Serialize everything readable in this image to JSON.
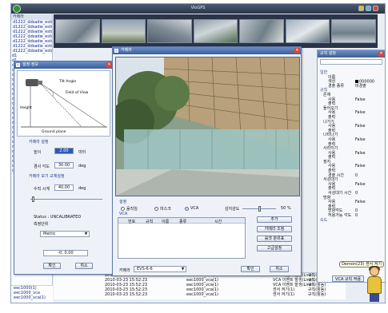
{
  "app": {
    "title": "VioGPS"
  },
  "tree": {
    "header": "카메라",
    "items": [
      "d1222_ddsadw_est(5)",
      "d1222_ddsadw_est(1)",
      "d1222_ddsadw_est(2)",
      "d1222_ddsadw_est(3)",
      "d1222_ddsadw_est(4)",
      "d1222_ddsadw_est(5)",
      "d1222_ddsadw_est(6)"
    ],
    "short_items": [
      "d1",
      "d1",
      "d1",
      "d1",
      "d1",
      "d1",
      "d1",
      "d1",
      "d1",
      "d1",
      "d1",
      "d1",
      "d1",
      "d1",
      "d1",
      "d1",
      "d1",
      "d1",
      "d1",
      "d1",
      "d1",
      "d1",
      "d1",
      "d1",
      "d1"
    ],
    "bottom_items": [
      "eec1000(1)",
      "eec1000_vca",
      "eec1000_vca(1)"
    ]
  },
  "camera_dialog": {
    "title": "설정 정보",
    "diagram_labels": {
      "tilt_angle": "Tilt Angle",
      "field_of_view": "Field of View",
      "height": "Height",
      "ground_plane": "Ground plane"
    },
    "section_camera": "카메라 설정",
    "height_label": "높이",
    "height_value": "2.00",
    "height_unit": "미터",
    "tilt_label": "경사 각도",
    "tilt_value": "30.00",
    "tilt_unit": "deg",
    "section_camera2": "카메라 보기 교체설정",
    "fov_label": "수직 시계",
    "fov_value": "40.00",
    "fov_unit": "deg",
    "status": "Status : UNCALIBRATED",
    "unit_label": "측정단위",
    "unit_value": "Metric",
    "coordinate_label": "-0, 0.00",
    "ok_button": "확인",
    "cancel_button": "취소"
  },
  "vca_dialog": {
    "title": "카메라",
    "group_label": "설정",
    "radio_motion": "움직임",
    "radio_mask": "마스크",
    "radio_vca": "VCA",
    "sensitivity_label": "감지감도",
    "sensitivity_value": "50 %",
    "vca_label": "VCA",
    "table_headers": [
      "번호",
      "규칙",
      "이름",
      "종류",
      "시간"
    ],
    "buttons": [
      "추가",
      "카메라 조정",
      "룰셋 분류표",
      "고급설정"
    ],
    "camera_label": "카메라",
    "camera_value": "EVS-6-6",
    "ok_button": "확인",
    "cancel_button": "취소"
  },
  "properties": {
    "title": "규칙 설정",
    "rows": [
      {
        "key": "일반",
        "value": "",
        "type": "group"
      },
      {
        "key": "이름",
        "value": "",
        "type": "item"
      },
      {
        "key": "색상",
        "value": "000000",
        "type": "color"
      },
      {
        "key": "경출 종류",
        "value": "비경출",
        "type": "item"
      },
      {
        "key": "규칙",
        "value": "",
        "type": "group"
      },
      {
        "key": "존재",
        "value": "",
        "type": "head"
      },
      {
        "key": "사용",
        "value": "False",
        "type": "item"
      },
      {
        "key": "출력",
        "value": "",
        "type": "item"
      },
      {
        "key": "들어오기",
        "value": "",
        "type": "head"
      },
      {
        "key": "사용",
        "value": "False",
        "type": "item"
      },
      {
        "key": "출력",
        "value": "",
        "type": "item"
      },
      {
        "key": "나가기",
        "value": "",
        "type": "head"
      },
      {
        "key": "사용",
        "value": "False",
        "type": "item"
      },
      {
        "key": "출력",
        "value": "",
        "type": "item"
      },
      {
        "key": "나타나기",
        "value": "",
        "type": "head"
      },
      {
        "key": "사용",
        "value": "False",
        "type": "item"
      },
      {
        "key": "출력",
        "value": "",
        "type": "item"
      },
      {
        "key": "사라지기",
        "value": "",
        "type": "head"
      },
      {
        "key": "사용",
        "value": "False",
        "type": "item"
      },
      {
        "key": "출력",
        "value": "",
        "type": "item"
      },
      {
        "key": "정지",
        "value": "",
        "type": "head"
      },
      {
        "key": "사용",
        "value": "False",
        "type": "item"
      },
      {
        "key": "출력",
        "value": "",
        "type": "item"
      },
      {
        "key": "경출 시간",
        "value": "0",
        "type": "item"
      },
      {
        "key": "서성대기",
        "value": "",
        "type": "head"
      },
      {
        "key": "사용",
        "value": "False",
        "type": "item"
      },
      {
        "key": "출력",
        "value": "",
        "type": "item"
      },
      {
        "key": "서성대기 시간",
        "value": "0",
        "type": "item"
      },
      {
        "key": "방향",
        "value": "",
        "type": "head"
      },
      {
        "key": "사용",
        "value": "False",
        "type": "item"
      },
      {
        "key": "출력",
        "value": "",
        "type": "item"
      },
      {
        "key": "방향각도",
        "value": "0",
        "type": "item"
      },
      {
        "key": "허용가능 각도",
        "value": "0",
        "type": "item"
      },
      {
        "key": "속도",
        "value": "",
        "type": "group"
      }
    ],
    "apply_button": "VCA 규칙 적용"
  },
  "tooltip": "Demon(23) 센서 켜기",
  "log": {
    "rows": [
      {
        "time": "2010-03-23 15:52:23",
        "source": "eec1000_vca(1)",
        "message": "VCA 이벤트 발생(Line), 규칙(규칙)",
        "status": "규칙(활동)"
      },
      {
        "time": "2010-03-23 15:52:23",
        "source": "eec1000_vca(1)",
        "message": "VCA 이벤트 발생(Line), 규칙(규칙)",
        "status": "규칙(활동)"
      },
      {
        "time": "2010-03-23 15:52:23",
        "source": "eec1000_vca(1)",
        "message": "VCA 이벤트 발생(Line)",
        "status": "규칙(활동)"
      },
      {
        "time": "2010-03-23 15:52:23",
        "source": "eec1000_vca(1)",
        "message": "센서 켜기(1)",
        "status": "규칙(활동)"
      },
      {
        "time": "2010-03-23 15:52:23",
        "source": "eec1000_vca(1)",
        "message": "센서 켜기(1)",
        "status": "규칙(활동)"
      }
    ]
  }
}
